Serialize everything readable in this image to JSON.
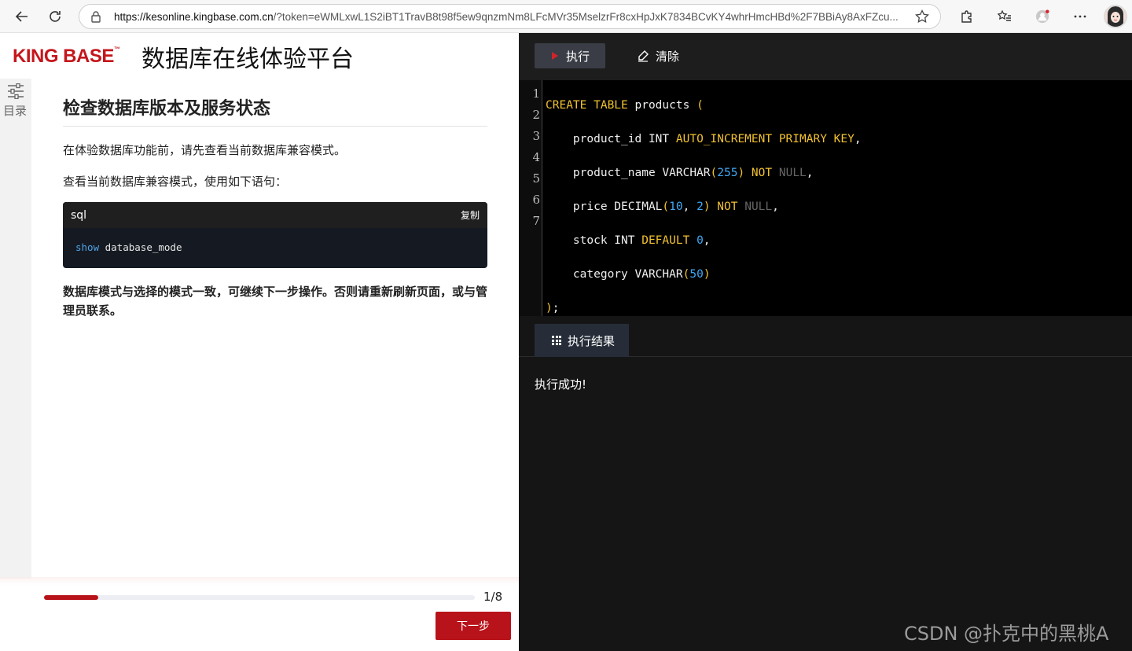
{
  "browser": {
    "url_domain": "https://kesonline.kingbase.com.cn",
    "url_rest": "/?token=eWMLxwL1S2iBT1TravB8t98f5ew9qnzmNm8LFcMVr35MselzrFr8cxHpJxK7834BCvKY4whrHmcHBd%2F7BBiAy8AxFZcu..."
  },
  "header": {
    "logo": "KING BASE",
    "logo_mark": "™",
    "title": "数据库在线体验平台"
  },
  "toc": {
    "label": "目录"
  },
  "lesson": {
    "heading": "检查数据库版本及服务状态",
    "para1": "在体验数据库功能前，请先查看当前数据库兼容模式。",
    "para2": "查看当前数据库兼容模式，使用如下语句：",
    "code_lang": "sql",
    "copy_label": "复制",
    "code_keyword": "show",
    "code_rest": " database_mode",
    "note": "数据库模式与选择的模式一致，可继续下一步操作。否则请重新刷新页面，或与管理员联系。"
  },
  "progress": {
    "current": 1,
    "total": 8,
    "text": "1/8",
    "fraction": 0.125
  },
  "next_label": "下一步",
  "editor": {
    "run_label": "执行",
    "clear_label": "清除",
    "line_numbers": [
      "1",
      "2",
      "3",
      "4",
      "5",
      "6",
      "7"
    ]
  },
  "results": {
    "tab_label": "执行结果",
    "message": "执行成功!"
  },
  "watermark": "CSDN @扑克中的黑桃A",
  "colors": {
    "brand_red": "#b8131a",
    "keyword": "#f2c230",
    "number": "#3fa9f5"
  }
}
